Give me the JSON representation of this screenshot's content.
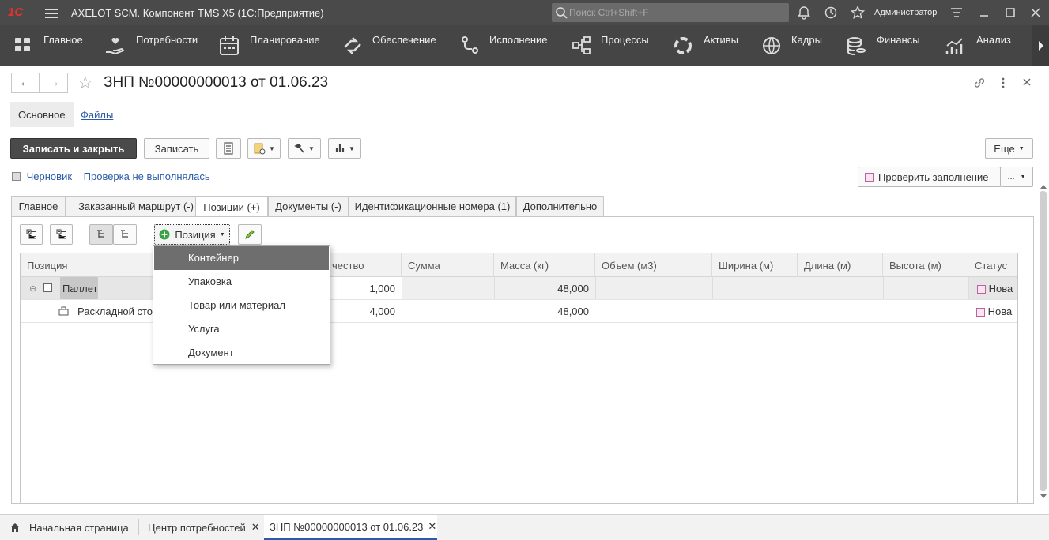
{
  "app": {
    "title": "AXELOT SCM. Компонент TMS X5  (1С:Предприятие)",
    "logo": "1С",
    "search_placeholder": "Поиск Ctrl+Shift+F",
    "user": "Администратор"
  },
  "nav": [
    "Главное",
    "Потребности",
    "Планирование",
    "Обеспечение",
    "Исполнение",
    "Процессы",
    "Активы",
    "Кадры",
    "Финансы",
    "Анализ"
  ],
  "doc": {
    "title": "ЗНП №00000000013 от 01.06.23"
  },
  "subtabs": {
    "main": "Основное",
    "files": "Файлы"
  },
  "toolbar": {
    "save_close": "Записать и закрыть",
    "save": "Записать",
    "more": "Еще"
  },
  "status": {
    "draft": "Черновик",
    "check": "Проверка не выполнялась",
    "check_fill": "Проверить заполнение",
    "dots": "..."
  },
  "tabs": [
    "Главное",
    "Заказанный маршрут (-)",
    "Позиции (+)",
    "Документы (-)",
    "Идентификационные номера (1)",
    "Дополнительно"
  ],
  "positions_toolbar": {
    "add": "Позиция"
  },
  "grid": {
    "headers": [
      "Позиция",
      "чество",
      "Сумма",
      "Масса (кг)",
      "Объем (м3)",
      "Ширина (м)",
      "Длина (м)",
      "Высота (м)",
      "Статус"
    ],
    "rows": [
      {
        "name": "Паллет",
        "qty": "1,000",
        "mass": "48,000",
        "status": "Нова"
      },
      {
        "name": "Раскладной сто",
        "qty": "4,000",
        "mass": "48,000",
        "status": "Нова"
      }
    ]
  },
  "dropdown": [
    "Контейнер",
    "Упаковка",
    "Товар или материал",
    "Услуга",
    "Документ"
  ],
  "bottom_tabs": [
    "Начальная страница",
    "Центр потребностей",
    "ЗНП №00000000013 от 01.06.23"
  ],
  "colors": {
    "titlebar": "#4a4a4a",
    "navbar": "#454545",
    "accent_link": "#2b5aa6",
    "highlight": "#6e6e6e"
  }
}
